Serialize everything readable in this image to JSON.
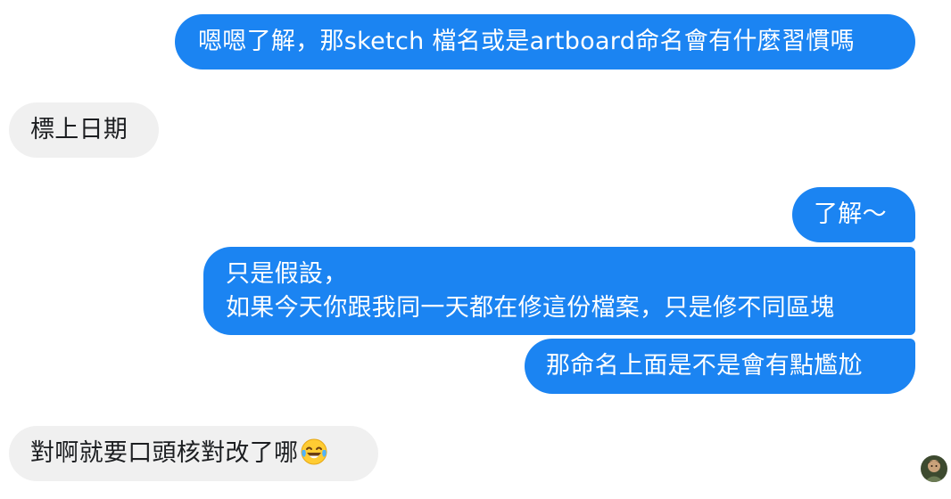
{
  "messages": [
    {
      "side": "outgoing",
      "text": "嗯嗯了解，那sketch 檔名或是artboard命名會有什麼習慣嗎"
    },
    {
      "side": "incoming",
      "text": "標上日期"
    },
    {
      "side": "outgoing",
      "text": "了解～"
    },
    {
      "side": "outgoing",
      "lines": [
        "只是假設，",
        "如果今天你跟我同一天都在修這份檔案，只是修不同區塊"
      ]
    },
    {
      "side": "outgoing",
      "text": "那命名上面是不是會有點尷尬"
    },
    {
      "side": "incoming",
      "text": "對啊就要口頭核對改了哪",
      "emoji": "face-with-tears-of-joy"
    }
  ],
  "colors": {
    "outgoing_bubble": "#1b84f2",
    "incoming_bubble": "#f0f0f0"
  },
  "read_receipt": {
    "icon": "avatar"
  }
}
